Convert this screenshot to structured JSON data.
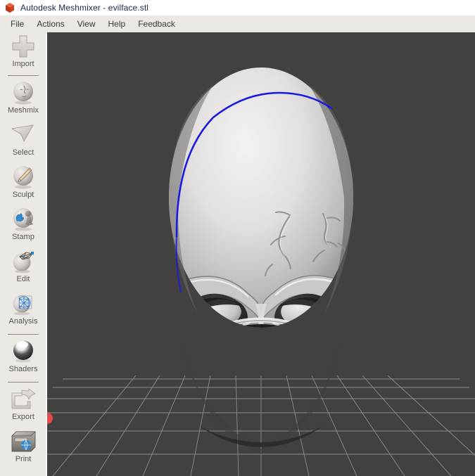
{
  "window": {
    "title": "Autodesk Meshmixer - evilface.stl",
    "logo_icon": "autodesk-cube-icon",
    "title_bar_color": "#ffffff",
    "menu_bar_color": "#ebe7e2",
    "sidebar_color": "#ece8e3",
    "viewport_color": "#424140"
  },
  "menubar": {
    "items": [
      {
        "label": "File",
        "name": "menu-file"
      },
      {
        "label": "Actions",
        "name": "menu-actions"
      },
      {
        "label": "View",
        "name": "menu-view"
      },
      {
        "label": "Help",
        "name": "menu-help"
      },
      {
        "label": "Feedback",
        "name": "menu-feedback"
      }
    ]
  },
  "sidebar": {
    "items": [
      {
        "label": "Import",
        "icon": "plus-icon",
        "name": "sidebar-item-import"
      },
      {
        "label": "Meshmix",
        "icon": "face-sphere-icon",
        "name": "sidebar-item-meshmix"
      },
      {
        "label": "Select",
        "icon": "cursor-arrow-icon",
        "name": "sidebar-item-select"
      },
      {
        "label": "Sculpt",
        "icon": "brush-sphere-icon",
        "name": "sidebar-item-sculpt"
      },
      {
        "label": "Stamp",
        "icon": "stamp-sphere-icon",
        "name": "sidebar-item-stamp"
      },
      {
        "label": "Edit",
        "icon": "mesh-sphere-icon",
        "name": "sidebar-item-edit"
      },
      {
        "label": "Analysis",
        "icon": "wireframe-sphere-icon",
        "name": "sidebar-item-analysis"
      },
      {
        "label": "Shaders",
        "icon": "shiny-sphere-icon",
        "name": "sidebar-item-shaders"
      },
      {
        "label": "Export",
        "icon": "export-arrow-icon",
        "name": "sidebar-item-export"
      },
      {
        "label": "Print",
        "icon": "printer-icon",
        "name": "sidebar-item-print"
      }
    ],
    "separators_after": [
      "Import",
      "Analysis",
      "Shaders"
    ]
  },
  "viewport": {
    "model_name": "evilface.stl",
    "model_description": "evil skull face 3D mesh, front view",
    "selection_outline_color": "#1a1ae0",
    "grid_color": "#9b9a98",
    "background_color": "#424140",
    "cursor_marker": {
      "name": "edge-hotspot-marker",
      "color": "#e8484b"
    }
  }
}
